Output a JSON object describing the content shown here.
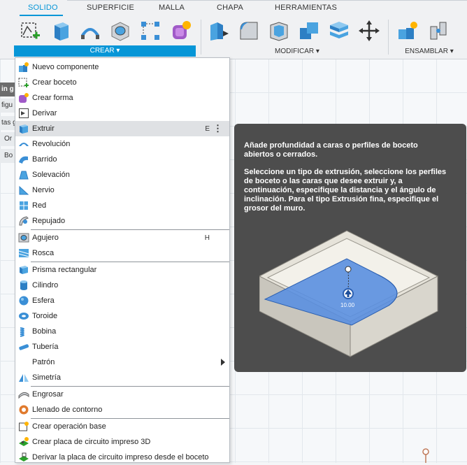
{
  "tabs": [
    {
      "label": "SOLIDO",
      "active": true
    },
    {
      "label": "SUPERFICIE",
      "active": false
    },
    {
      "label": "MALLA",
      "active": false
    },
    {
      "label": "CHAPA",
      "active": false
    },
    {
      "label": "HERRAMIENTAS",
      "active": false
    }
  ],
  "groups": {
    "crear": "CREAR ▾",
    "modificar": "MODIFICAR ▾",
    "ensamblar": "ENSAMBLAR ▾"
  },
  "browser": {
    "items": [
      "in g",
      "figu",
      "tas g",
      "Or",
      "Bo"
    ]
  },
  "menu": {
    "items": [
      {
        "label": "Nuevo componente",
        "icon": "new-component-icon"
      },
      {
        "label": "Crear boceto",
        "icon": "sketch-icon"
      },
      {
        "label": "Crear forma",
        "icon": "form-icon"
      },
      {
        "label": "Derivar",
        "icon": "derive-icon"
      },
      {
        "label": "Extruir",
        "icon": "extrude-icon",
        "shortcut": "E",
        "highlighted": true
      },
      {
        "label": "Revolución",
        "icon": "revolve-icon"
      },
      {
        "label": "Barrido",
        "icon": "sweep-icon"
      },
      {
        "label": "Solevación",
        "icon": "loft-icon"
      },
      {
        "label": "Nervio",
        "icon": "rib-icon"
      },
      {
        "label": "Red",
        "icon": "web-icon"
      },
      {
        "label": "Repujado",
        "icon": "emboss-icon"
      },
      {
        "label": "Agujero",
        "icon": "hole-icon",
        "shortcut": "H"
      },
      {
        "label": "Rosca",
        "icon": "thread-icon"
      },
      {
        "label": "Prisma rectangular",
        "icon": "box-icon"
      },
      {
        "label": "Cilindro",
        "icon": "cylinder-icon"
      },
      {
        "label": "Esfera",
        "icon": "sphere-icon"
      },
      {
        "label": "Toroide",
        "icon": "torus-icon"
      },
      {
        "label": "Bobina",
        "icon": "coil-icon"
      },
      {
        "label": "Tubería",
        "icon": "pipe-icon"
      },
      {
        "label": "Patrón",
        "icon": "",
        "submenu": true
      },
      {
        "label": "Simetría",
        "icon": "mirror-icon"
      },
      {
        "label": "Engrosar",
        "icon": "thicken-icon"
      },
      {
        "label": "Llenado de contorno",
        "icon": "boundary-fill-icon"
      },
      {
        "label": "Crear operación base",
        "icon": "base-feature-icon"
      },
      {
        "label": "Crear placa de circuito impreso 3D",
        "icon": "pcb-3d-icon"
      },
      {
        "label": "Derivar la placa de circuito impreso desde el boceto",
        "icon": "pcb-derive-icon"
      }
    ],
    "more": "⋮"
  },
  "tooltip": {
    "title": "Añade profundidad a caras o perfiles de boceto abiertos o cerrados.",
    "description": "Seleccione un tipo de extrusión, seleccione los perfiles de boceto o las caras que desee extruir y, a continuación, especifique la distancia y el ángulo de inclinación. Para el tipo Extrusión fina, especifique el grosor del muro.",
    "illustration_value": "10.00"
  },
  "colors": {
    "accent": "#0696d7",
    "tooltip_bg": "#4d4d4d",
    "menu_highlight": "#dfe1e4"
  }
}
